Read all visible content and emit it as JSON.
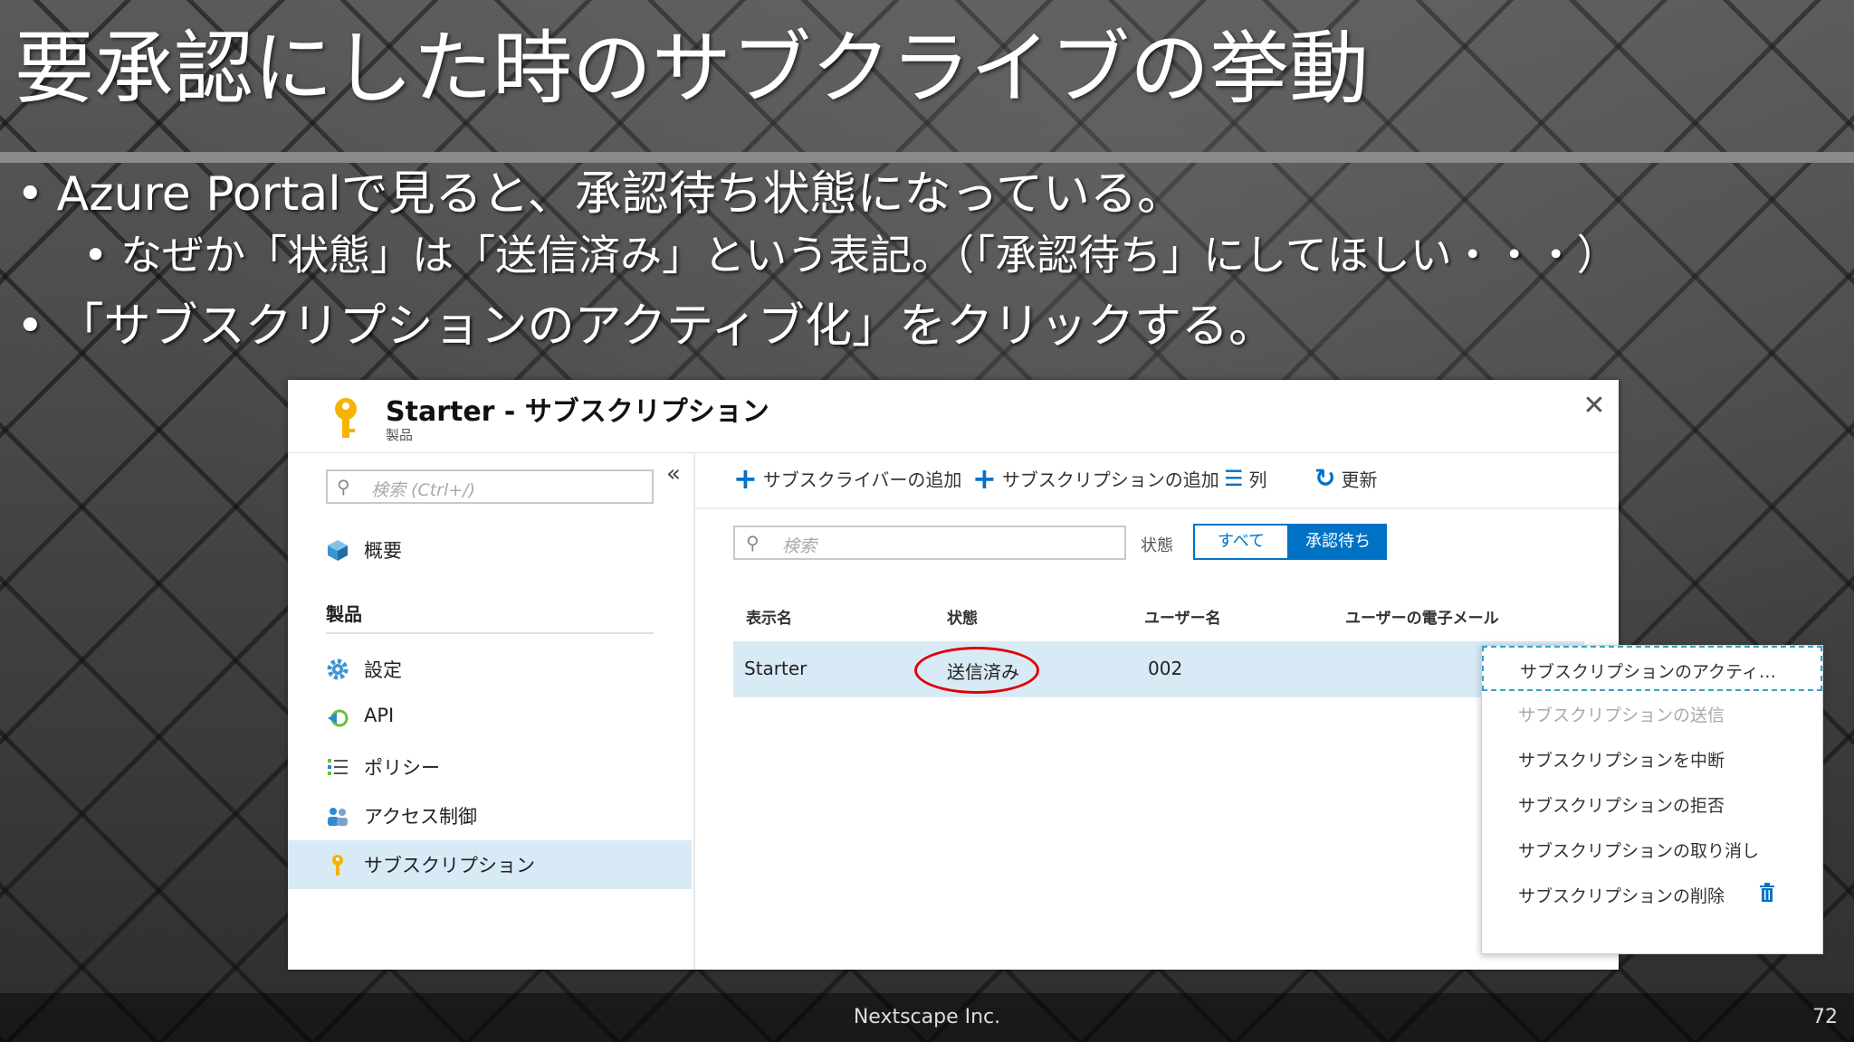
{
  "slide": {
    "title": "要承認にした時のサブクライブの挙動",
    "bullet1": "Azure Portalで見ると、承認待ち状態になっている。",
    "bullet2": "なぜか「状態」は「送信済み」という表記。（「承認待ち」にしてほしい・・・）",
    "bullet3": "「サブスクリプションのアクティブ化」をクリックする。",
    "bullet_marker": "•"
  },
  "blade": {
    "title": "Starter - サブスクリプション",
    "subtitle": "製品",
    "close_glyph": "✕"
  },
  "sidebar": {
    "collapse_glyph": "«",
    "search_placeholder": "検索 (Ctrl+/)",
    "overview": "概要",
    "section_label": "製品",
    "items": [
      {
        "label": "設定"
      },
      {
        "label": "API"
      },
      {
        "label": "ポリシー"
      },
      {
        "label": "アクセス制御"
      },
      {
        "label": "サブスクリプション"
      }
    ]
  },
  "toolbar": {
    "add_subscriber": "サブスクライバーの追加",
    "add_subscription": "サブスクリプションの追加",
    "columns": "列",
    "refresh": "更新"
  },
  "filter": {
    "search_placeholder": "検索",
    "state_label": "状態",
    "opt_all": "すべて",
    "opt_pending": "承認待ち"
  },
  "table": {
    "headers": [
      "表示名",
      "状態",
      "ユーザー名",
      "ユーザーの電子メール"
    ],
    "row": {
      "name": "Starter",
      "state": "送信済み",
      "user": "002"
    },
    "more_glyph": "•••"
  },
  "context_menu": {
    "items": [
      "サブスクリプションのアクティ…",
      "サブスクリプションの送信",
      "サブスクリプションを中断",
      "サブスクリプションの拒否",
      "サブスクリプションの取り消し",
      "サブスクリプションの削除"
    ]
  },
  "footer": {
    "company": "Nextscape Inc.",
    "page": "72"
  },
  "colors": {
    "accent": "#0072c6",
    "selection": "#d9eaf7",
    "highlight_circle": "#e00000"
  }
}
